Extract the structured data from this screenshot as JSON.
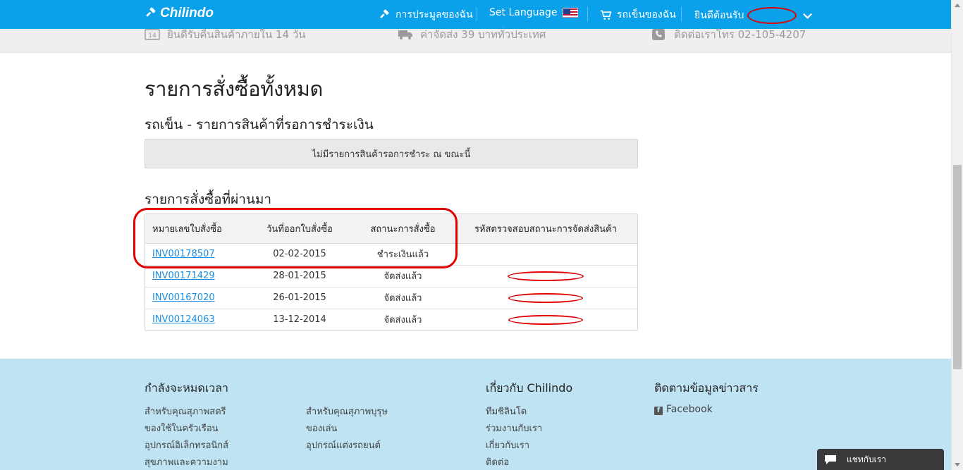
{
  "nav": {
    "logo": "Chilindo",
    "auction_label": "การประมูลของฉัน",
    "language_label": "Set Language",
    "cart_label": "รถเข็นของฉัน",
    "welcome_label": "ยินดีต้อนรับ"
  },
  "info": {
    "return_badge": "14",
    "returns": "ยินดีรับคืนสินค้าภายใน 14 วัน",
    "shipping": "ค่าจัดส่ง 39 บาททั่วประเทศ",
    "contact": "ติดต่อเราโทร 02-105-4207"
  },
  "page": {
    "title": "รายการสั่งซื้อทั้งหมด",
    "cart_heading": "รถเข็น - รายการสินค้าที่รอการชำระเงิน",
    "cart_empty": "ไม่มีรายการสินค้ารอการชำระ ณ ขณะนี้",
    "history_heading": "รายการสั่งซื้อที่ผ่านมา"
  },
  "orders": {
    "headers": [
      "หมายเลขใบสั่งซื้อ",
      "วันที่ออกใบสั่งซื้อ",
      "สถานะการสั่งซื้อ",
      "รหัสตรวจสอบสถานะการจัดส่งสินค้า"
    ],
    "rows": [
      {
        "invoice": "INV00178507",
        "date": "02-02-2015",
        "status": "ชำระเงินแล้ว",
        "tracking": ""
      },
      {
        "invoice": "INV00171429",
        "date": "28-01-2015",
        "status": "จัดส่งแล้ว",
        "tracking": ""
      },
      {
        "invoice": "INV00167020",
        "date": "26-01-2015",
        "status": "จัดส่งแล้ว",
        "tracking": ""
      },
      {
        "invoice": "INV00124063",
        "date": "13-12-2014",
        "status": "จัดส่งแล้ว",
        "tracking": ""
      }
    ]
  },
  "footer": {
    "col1_title": "กำลังจะหมดเวลา",
    "col1_links": [
      "สำหรับคุณสุภาพสตรี",
      "ของใช้ในครัวเรือน",
      "อุปกรณ์อิเล็กทรอนิกส์",
      "สุขภาพและความงาม"
    ],
    "col2_links": [
      "สำหรับคุณสุภาพบุรุษ",
      "ของเล่น",
      "อุปกรณ์แต่งรถยนต์"
    ],
    "col3_title": "เกี่ยวกับ Chilindo",
    "col3_links": [
      "ทีมชิลินโด",
      "ร่วมงานกับเรา",
      "เกี่ยวกับเรา",
      "ติดต่อ"
    ],
    "col4_title": "ติดตามข้อมูลข่าวสาร",
    "facebook": "Facebook"
  },
  "chat": {
    "label": "แชทกับเรา"
  },
  "colors": {
    "nav": "#0aa0ea",
    "footer": "#bfe3f2",
    "link": "#1a8ee0",
    "annotation": "#e10000"
  }
}
